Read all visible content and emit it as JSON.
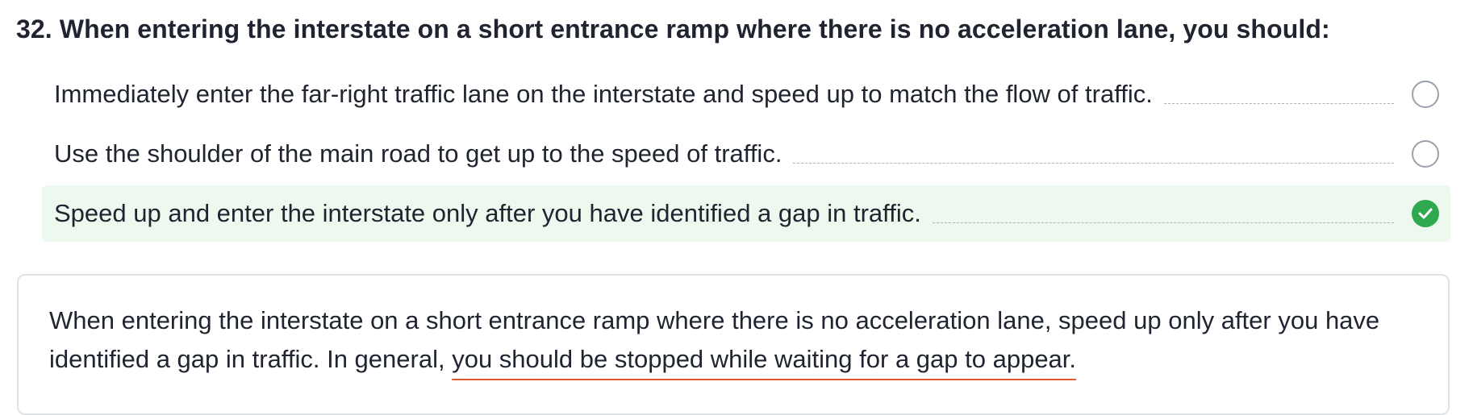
{
  "question": {
    "title": "32. When entering the interstate on a short entrance ramp where there is no acceleration lane, you should:"
  },
  "options": [
    {
      "text": "Immediately enter the far-right traffic lane on the interstate and speed up to match the flow of traffic.",
      "state": "unselected",
      "icon": "radio-empty-icon"
    },
    {
      "text": "Use the shoulder of the main road to get up to the speed of traffic.",
      "state": "unselected",
      "icon": "radio-empty-icon"
    },
    {
      "text": "Speed up and enter the interstate only after you have identified a gap in traffic.",
      "state": "correct",
      "icon": "check-circle-icon"
    }
  ],
  "explanation": {
    "text_before": "When entering the interstate on a short entrance ramp where there is no acceleration lane, speed up only after you have identified a gap in traffic. In general, ",
    "highlighted": "you should be stopped while waiting for a gap to appear."
  },
  "colors": {
    "correct_background": "#edf8ee",
    "correct_check": "#2fa84f",
    "highlight_underline": "#e25a2c"
  }
}
